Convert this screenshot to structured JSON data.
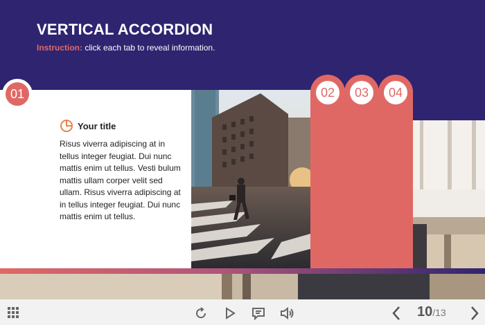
{
  "header": {
    "title": "VERTICAL ACCORDION",
    "instruction_label": "Instruction:",
    "instruction_text": " click each tab to reveal information."
  },
  "accordion": {
    "tabs": [
      {
        "number": "01"
      },
      {
        "number": "02"
      },
      {
        "number": "03"
      },
      {
        "number": "04"
      }
    ],
    "active": {
      "title": "Your title",
      "body": "Risus viverra adipiscing at in tellus integer feugiat. Dui nunc mattis enim ut tellus. Vesti bulum mattis ullam corper velit sed ullam. Risus viverra adipiscing at in tellus integer feugiat. Dui nunc mattis enim ut tellus."
    }
  },
  "colors": {
    "header_bg": "#2f2470",
    "accent": "#e06864"
  },
  "controls": {
    "page_current": "10",
    "page_total": "/13"
  }
}
